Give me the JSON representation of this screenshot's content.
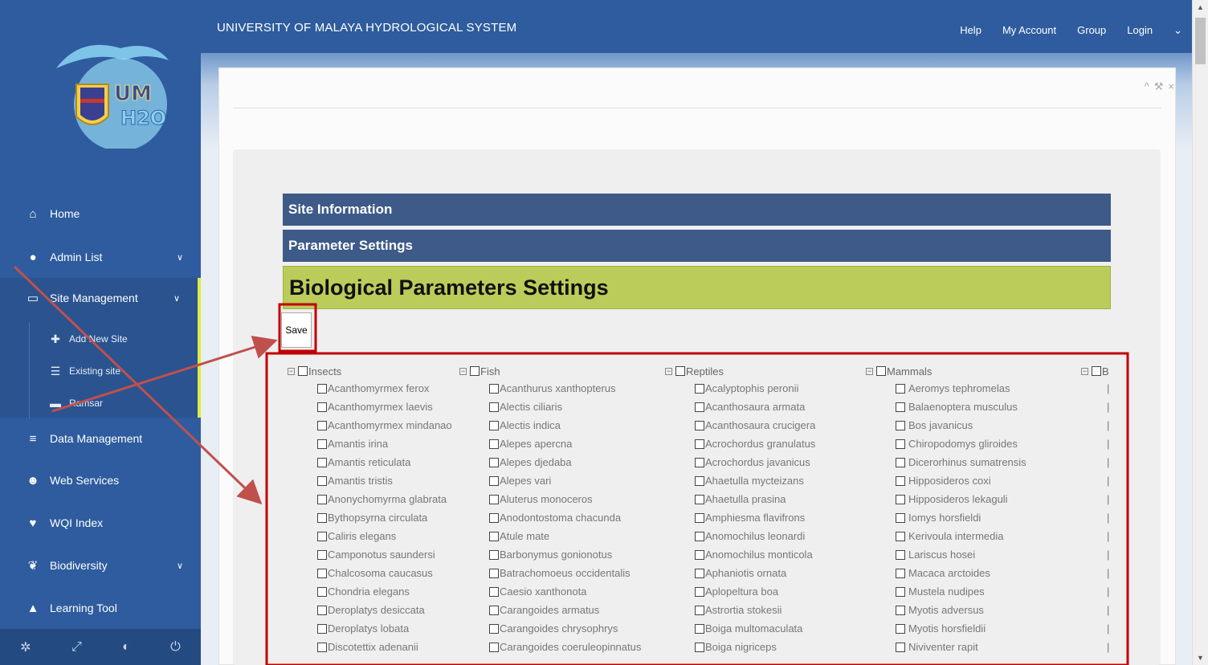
{
  "app": {
    "title": "UNIVERSITY OF MALAYA HYDROLOGICAL SYSTEM",
    "logo_text_top": "UM",
    "logo_text_bottom": "H2O"
  },
  "top_menu": {
    "help": "Help",
    "my_account": "My Account",
    "group": "Group",
    "login": "Login",
    "caret": "⌄"
  },
  "sidebar": {
    "items": [
      {
        "label": "Home",
        "icon": "home-icon"
      },
      {
        "label": "Admin List",
        "icon": "user-icon",
        "has_chevron": true
      },
      {
        "label": "Site Management",
        "icon": "monitor-icon",
        "has_chevron": true
      },
      {
        "label": "Data Management",
        "icon": "database-icon"
      },
      {
        "label": "Web Services",
        "icon": "users-icon"
      },
      {
        "label": "WQI Index",
        "icon": "heart-icon"
      },
      {
        "label": "Biodiversity",
        "icon": "leaf-icon",
        "has_chevron": true
      },
      {
        "label": "Learning Tool",
        "icon": "graduation-cap-icon"
      }
    ],
    "sub_items": [
      {
        "label": "Add New Site",
        "icon": "plus-icon"
      },
      {
        "label": "Existing site",
        "icon": "list-icon"
      },
      {
        "label": "Ramsar",
        "icon": "folder-icon"
      }
    ]
  },
  "panel": {
    "bands": {
      "site_information": "Site Information",
      "parameter_settings": "Parameter Settings",
      "biological_settings": "Biological Parameters Settings"
    },
    "save_label": "Save"
  },
  "tree": {
    "columns": [
      {
        "name": "Insects",
        "items": [
          "Acanthomyrmex ferox",
          "Acanthomyrmex laevis",
          "Acanthomyrmex mindanao",
          "Amantis irina",
          "Amantis reticulata",
          "Amantis tristis",
          "Anonychomyrma glabrata",
          "Bythopsyrna circulata",
          "Caliris elegans",
          "Camponotus saundersi",
          "Chalcosoma caucasus",
          "Chondria elegans",
          "Deroplatys desiccata",
          "Deroplatys lobata",
          "Discotettix adenanii"
        ]
      },
      {
        "name": "Fish",
        "items": [
          "Acanthurus xanthopterus",
          "Alectis ciliaris",
          "Alectis indica",
          "Alepes apercna",
          "Alepes djedaba",
          "Alepes vari",
          "Aluterus monoceros",
          "Anodontostoma chacunda",
          "Atule mate",
          "Barbonymus gonionotus",
          "Batrachomoeus occidentalis",
          "Caesio xanthonota",
          "Carangoides armatus",
          "Carangoides chrysophrys",
          "Carangoides coeruleopinnatus"
        ]
      },
      {
        "name": "Reptiles",
        "items": [
          "Acalyptophis peronii",
          "Acanthosaura armata",
          "Acanthosaura crucigera",
          "Acrochordus granulatus",
          "Acrochordus javanicus",
          "Ahaetulla mycteizans",
          "Ahaetulla prasina",
          "Amphiesma flavifrons",
          "Anomochilus leonardi",
          "Anomochilus monticola",
          "Aphaniotis ornata",
          "Aplopeltura boa",
          "Astrortia stokesii",
          "Boiga multomaculata",
          "Boiga nigriceps"
        ]
      },
      {
        "name": "Mammals",
        "items": [
          "Aeromys tephromelas",
          "Balaenoptera musculus",
          "Bos javanicus",
          "Chiropodomys gliroides",
          "Dicerorhinus sumatrensis",
          "Hipposideros coxi",
          "Hipposideros lekaguli",
          "Iomys horsfieldi",
          "Kerivoula intermedia",
          "Lariscus hosei",
          "Macaca arctoides",
          "Mustela nudipes",
          "Myotis adversus",
          "Myotis horsfieldii",
          "Niviventer rapit"
        ]
      },
      {
        "name": "B",
        "items": [
          "|",
          "|",
          "|",
          "|",
          "|",
          "|",
          "|",
          "|",
          "|",
          "|",
          "|",
          "|",
          "|",
          "|",
          "|"
        ]
      }
    ]
  },
  "colors": {
    "sidebar": "#2e5c9e",
    "band": "#3d5a88",
    "bio_band": "#bccc5a",
    "annotation": "#c00000",
    "arrow": "#c0504d"
  }
}
